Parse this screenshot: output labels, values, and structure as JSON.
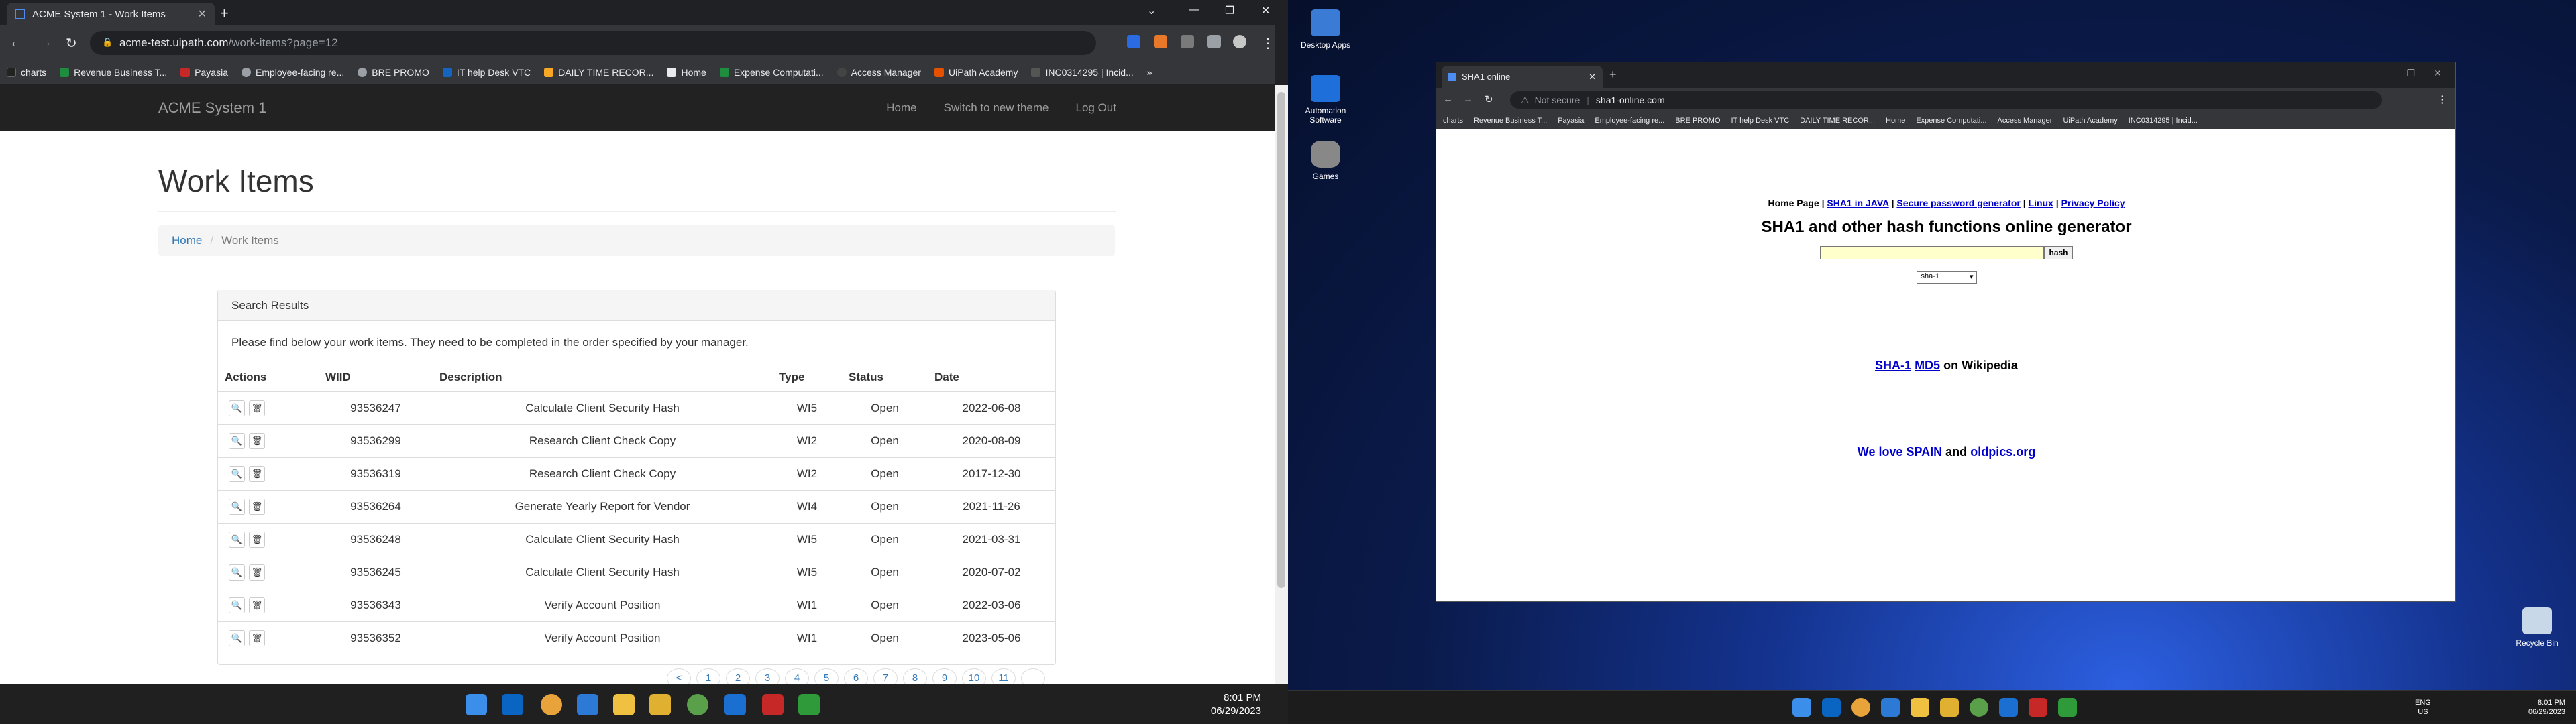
{
  "left_browser": {
    "tab_title": "ACME System 1 - Work Items",
    "url_host": "acme-test.uipath.com",
    "url_path": "/work-items?page=12",
    "bookmarks": [
      "charts",
      "Revenue Business T...",
      "Payasia",
      "Employee-facing re...",
      "BRE PROMO",
      "IT help Desk VTC",
      "DAILY TIME RECOR...",
      "Home",
      "Expense Computati...",
      "Access Manager",
      "UiPath Academy",
      "INC0314295 | Incid..."
    ]
  },
  "acme": {
    "brand": "ACME System 1",
    "nav": [
      "Home",
      "Switch to new theme",
      "Log Out"
    ],
    "title": "Work Items",
    "breadcrumb": {
      "home": "Home",
      "current": "Work Items"
    },
    "panel_heading": "Search Results",
    "panel_text": "Please find below your work items. They need to be completed in the order specified by your manager.",
    "columns": [
      "Actions",
      "WIID",
      "Description",
      "Type",
      "Status",
      "Date"
    ],
    "rows": [
      {
        "wiid": "93536247",
        "desc": "Calculate Client Security Hash",
        "type": "WI5",
        "status": "Open",
        "date": "2022-06-08"
      },
      {
        "wiid": "93536299",
        "desc": "Research Client Check Copy",
        "type": "WI2",
        "status": "Open",
        "date": "2020-08-09"
      },
      {
        "wiid": "93536319",
        "desc": "Research Client Check Copy",
        "type": "WI2",
        "status": "Open",
        "date": "2017-12-30"
      },
      {
        "wiid": "93536264",
        "desc": "Generate Yearly Report for Vendor",
        "type": "WI4",
        "status": "Open",
        "date": "2021-11-26"
      },
      {
        "wiid": "93536248",
        "desc": "Calculate Client Security Hash",
        "type": "WI5",
        "status": "Open",
        "date": "2021-03-31"
      },
      {
        "wiid": "93536245",
        "desc": "Calculate Client Security Hash",
        "type": "WI5",
        "status": "Open",
        "date": "2020-07-02"
      },
      {
        "wiid": "93536343",
        "desc": "Verify Account Position",
        "type": "WI1",
        "status": "Open",
        "date": "2022-03-06"
      },
      {
        "wiid": "93536352",
        "desc": "Verify Account Position",
        "type": "WI1",
        "status": "Open",
        "date": "2023-05-06"
      }
    ],
    "pages": [
      "<",
      "1",
      "2",
      "3",
      "4",
      "5",
      "6",
      "7",
      "8",
      "9",
      "10",
      "11",
      ""
    ]
  },
  "taskbar1": {
    "time": "8:01 PM",
    "date": "06/29/2023"
  },
  "desktop_icons": [
    "Desktop Apps",
    "Automation Software",
    "Games",
    "Recycle Bin"
  ],
  "right_browser": {
    "tab_title": "SHA1 online",
    "not_secure": "Not secure",
    "url": "sha1-online.com",
    "bookmarks": [
      "charts",
      "Revenue Business T...",
      "Payasia",
      "Employee-facing re...",
      "BRE PROMO",
      "IT help Desk VTC",
      "DAILY TIME RECOR...",
      "Home",
      "Expense Computati...",
      "Access Manager",
      "UiPath Academy",
      "INC0314295 | Incid..."
    ]
  },
  "sha": {
    "links_prefix": "Home Page",
    "links": [
      "SHA1 in JAVA",
      "Secure password generator",
      "Linux",
      "Privacy Policy"
    ],
    "title": "SHA1 and other hash functions online generator",
    "hash_button": "hash",
    "select_value": "sha-1",
    "wiki_a": "SHA-1",
    "wiki_b": "MD5",
    "wiki_suffix": "on Wikipedia",
    "spain_a": "We love SPAIN",
    "spain_and": "and",
    "spain_b": "oldpics.org"
  },
  "taskbar2": {
    "lang": "ENG",
    "region": "US",
    "time": "8:01 PM",
    "date": "06/29/2023"
  }
}
